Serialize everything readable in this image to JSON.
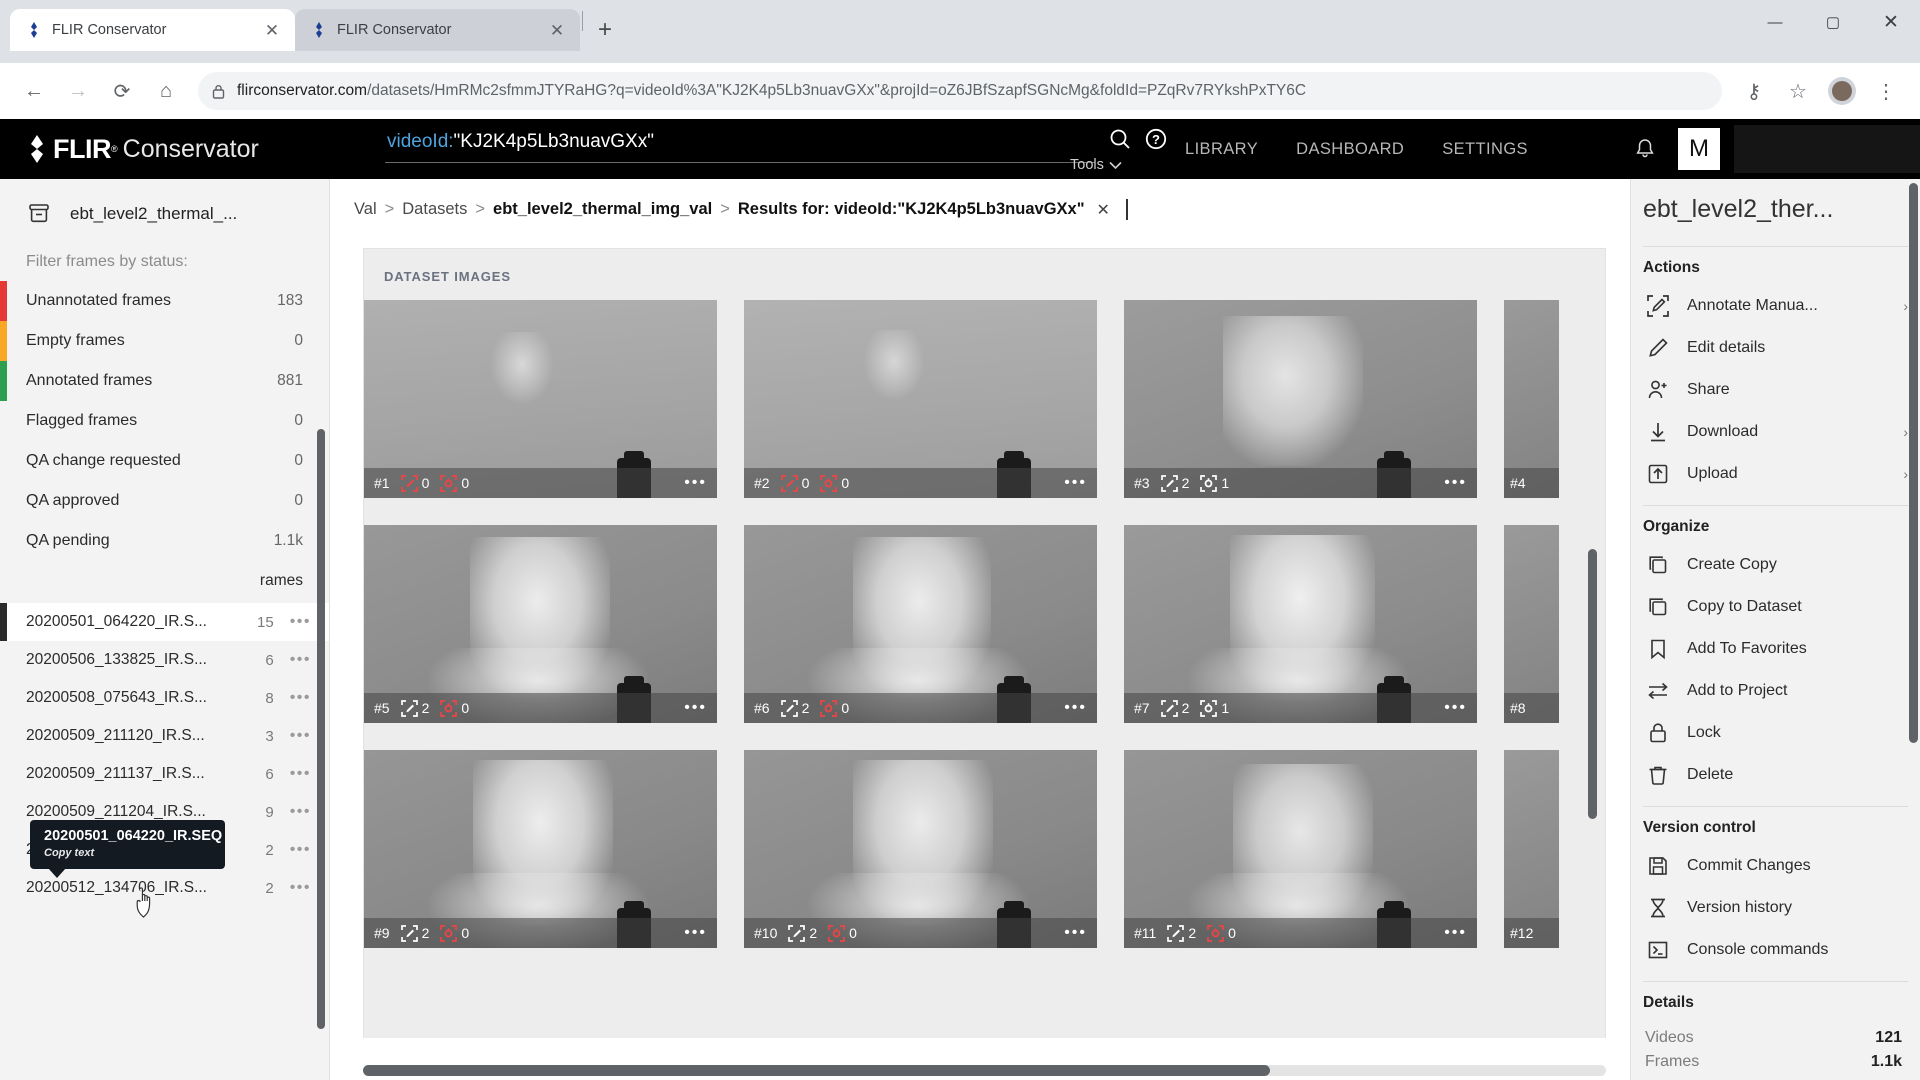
{
  "browser": {
    "tabs": [
      {
        "title": "FLIR Conservator",
        "close": "✕",
        "active": true
      },
      {
        "title": "FLIR Conservator",
        "close": "✕",
        "active": false
      }
    ],
    "new_tab": "+",
    "window_controls": {
      "minimize": "—",
      "maximize": "▢",
      "close": "✕"
    },
    "nav": {
      "back": "←",
      "forward": "→",
      "reload": "⟳",
      "home": "⌂"
    },
    "url_host": "flirconservator.com",
    "url_path": "/datasets/HmRMc2sfmmJTYRaHG?q=videoId%3A\"KJ2K4p5Lb3nuavGXx\"&projId=oZ6JBfSzapfSGNcMg&foldId=PZqRv7RYkshPxTY6C",
    "lock_icon": "🔒",
    "key_icon": "⚷",
    "star_icon": "☆",
    "menu_icon": "⋮"
  },
  "app_header": {
    "brand_flir": "FLIR",
    "brand_reg": "®",
    "brand_conservator": "Conservator",
    "search_field": "videoId:\"KJ2K4p5Lb3nuavGXx\"",
    "search_key": "videoId:",
    "search_value": "\"KJ2K4p5Lb3nuavGXx\"",
    "tools_label": "Tools",
    "tools_caret": "⌄",
    "search_icon": "search-icon",
    "help_icon": "?",
    "nav_items": [
      "LIBRARY",
      "DASHBOARD",
      "SETTINGS"
    ],
    "bell_icon": "bell-icon",
    "avatar_letter": "M"
  },
  "sidebar": {
    "dataset_name": "ebt_level2_thermal_...",
    "filter_label": "Filter frames by status:",
    "statuses": [
      {
        "label": "Unannotated frames",
        "count": "183",
        "color": "#e53935"
      },
      {
        "label": "Empty frames",
        "count": "0",
        "color": "#f9a825"
      },
      {
        "label": "Annotated frames",
        "count": "881",
        "color": "#2e9e4f"
      },
      {
        "label": "Flagged frames",
        "count": "0",
        "color": "transparent"
      },
      {
        "label": "QA change requested",
        "count": "0",
        "color": "transparent"
      },
      {
        "label": "QA approved",
        "count": "0",
        "color": "transparent"
      },
      {
        "label": "QA pending",
        "count": "1.1k",
        "color": "transparent"
      }
    ],
    "hidden_label": "rames",
    "tooltip": {
      "title": "20200501_064220_IR.SEQ",
      "subtitle": "Copy text"
    },
    "files": [
      {
        "name": "20200501_064220_IR.S...",
        "count": "15",
        "dots": "•••",
        "highlighted": true
      },
      {
        "name": "20200506_133825_IR.S...",
        "count": "6",
        "dots": "•••",
        "highlighted": false
      },
      {
        "name": "20200508_075643_IR.S...",
        "count": "8",
        "dots": "•••",
        "highlighted": false
      },
      {
        "name": "20200509_211120_IR.S...",
        "count": "3",
        "dots": "•••",
        "highlighted": false
      },
      {
        "name": "20200509_211137_IR.S...",
        "count": "6",
        "dots": "•••",
        "highlighted": false
      },
      {
        "name": "20200509_211204_IR.S...",
        "count": "9",
        "dots": "•••",
        "highlighted": false
      },
      {
        "name": "20200512_134542_IR.S...",
        "count": "2",
        "dots": "•••",
        "highlighted": false
      },
      {
        "name": "20200512_134706_IR.S...",
        "count": "2",
        "dots": "•••",
        "highlighted": false
      }
    ]
  },
  "breadcrumb": {
    "items": [
      "Val",
      "Datasets",
      "ebt_level2_thermal_img_val",
      "Results for: videoId:\"KJ2K4p5Lb3nuavGXx\""
    ],
    "separator": ">",
    "close": "✕"
  },
  "content": {
    "panel_header": "DATASET IMAGES",
    "thumbnails": [
      {
        "num": "#1",
        "annotations": "0",
        "objects": "0",
        "red": true,
        "dots": "•••",
        "img": "hand"
      },
      {
        "num": "#2",
        "annotations": "0",
        "objects": "0",
        "red": true,
        "dots": "•••",
        "img": "hand"
      },
      {
        "num": "#3",
        "annotations": "2",
        "objects": "1",
        "red": false,
        "dots": "•••",
        "img": "face-side"
      },
      {
        "num": "#4",
        "annotations": "",
        "objects": "",
        "red": false,
        "dots": "",
        "img": "clip"
      },
      {
        "num": "#5",
        "annotations": "2",
        "objects": "0",
        "red": "mixed",
        "dots": "•••",
        "img": "face"
      },
      {
        "num": "#6",
        "annotations": "2",
        "objects": "0",
        "red": "mixed",
        "dots": "•••",
        "img": "face"
      },
      {
        "num": "#7",
        "annotations": "2",
        "objects": "1",
        "red": false,
        "dots": "•••",
        "img": "face-up"
      },
      {
        "num": "#8",
        "annotations": "",
        "objects": "",
        "red": false,
        "dots": "",
        "img": "clip"
      },
      {
        "num": "#9",
        "annotations": "2",
        "objects": "0",
        "red": "mixed",
        "dots": "•••",
        "img": "face"
      },
      {
        "num": "#10",
        "annotations": "2",
        "objects": "0",
        "red": "mixed",
        "dots": "•••",
        "img": "face"
      },
      {
        "num": "#11",
        "annotations": "2",
        "objects": "0",
        "red": "mixed",
        "dots": "•••",
        "img": "face-down"
      },
      {
        "num": "#12",
        "annotations": "",
        "objects": "",
        "red": false,
        "dots": "",
        "img": "clip"
      }
    ]
  },
  "right_panel": {
    "title": "ebt_level2_ther...",
    "sections": [
      {
        "heading": "Actions",
        "items": [
          {
            "label": "Annotate Manua...",
            "icon": "annotate-icon",
            "chevron": "›"
          },
          {
            "label": "Edit details",
            "icon": "pencil-icon",
            "chevron": ""
          },
          {
            "label": "Share",
            "icon": "share-person-icon",
            "chevron": ""
          },
          {
            "label": "Download",
            "icon": "download-icon",
            "chevron": "›"
          },
          {
            "label": "Upload",
            "icon": "upload-icon",
            "chevron": "›"
          }
        ]
      },
      {
        "heading": "Organize",
        "items": [
          {
            "label": "Create Copy",
            "icon": "copy-icon",
            "chevron": ""
          },
          {
            "label": "Copy to Dataset",
            "icon": "copy-icon",
            "chevron": ""
          },
          {
            "label": "Add To Favorites",
            "icon": "bookmark-icon",
            "chevron": ""
          },
          {
            "label": "Add to Project",
            "icon": "move-arrows-icon",
            "chevron": ""
          },
          {
            "label": "Lock",
            "icon": "lock-icon",
            "chevron": ""
          },
          {
            "label": "Delete",
            "icon": "trash-icon",
            "chevron": ""
          }
        ]
      },
      {
        "heading": "Version control",
        "items": [
          {
            "label": "Commit Changes",
            "icon": "save-icon",
            "chevron": ""
          },
          {
            "label": "Version history",
            "icon": "hourglass-icon",
            "chevron": ""
          },
          {
            "label": "Console commands",
            "icon": "terminal-icon",
            "chevron": ""
          }
        ]
      }
    ],
    "details_heading": "Details",
    "details": [
      {
        "key": "Videos",
        "value": "121"
      },
      {
        "key": "Frames",
        "value": "1.1k"
      }
    ]
  }
}
